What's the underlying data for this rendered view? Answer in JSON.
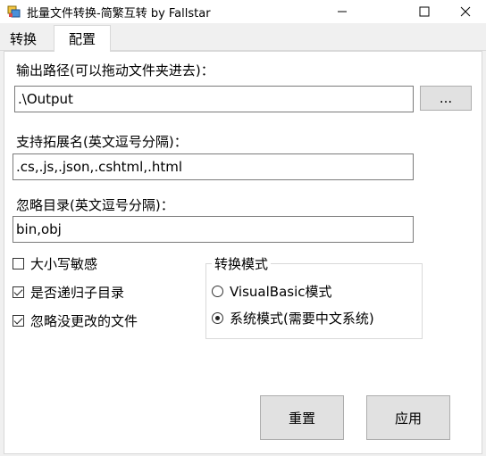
{
  "window": {
    "title": "批量文件转换-简繁互转 by Fallstar"
  },
  "tabs": [
    {
      "label": "转换",
      "selected": false
    },
    {
      "label": "配置",
      "selected": true
    }
  ],
  "config": {
    "output_path": {
      "label": "输出路径(可以拖动文件夹进去)：",
      "value": ".\\Output",
      "browse_label": "..."
    },
    "extensions": {
      "label": "支持拓展名(英文逗号分隔)：",
      "value": ".cs,.js,.json,.cshtml,.html"
    },
    "ignore_dirs": {
      "label": "忽略目录(英文逗号分隔)：",
      "value": "bin,obj"
    },
    "checkboxes": [
      {
        "label": "大小写敏感",
        "checked": false
      },
      {
        "label": "是否递归子目录",
        "checked": true
      },
      {
        "label": "忽略没更改的文件",
        "checked": true
      }
    ],
    "mode_group": {
      "title": "转换模式",
      "options": [
        {
          "label": "VisualBasic模式",
          "selected": false
        },
        {
          "label": "系统模式(需要中文系统)",
          "selected": true
        }
      ]
    },
    "reset_label": "重置",
    "apply_label": "应用"
  }
}
